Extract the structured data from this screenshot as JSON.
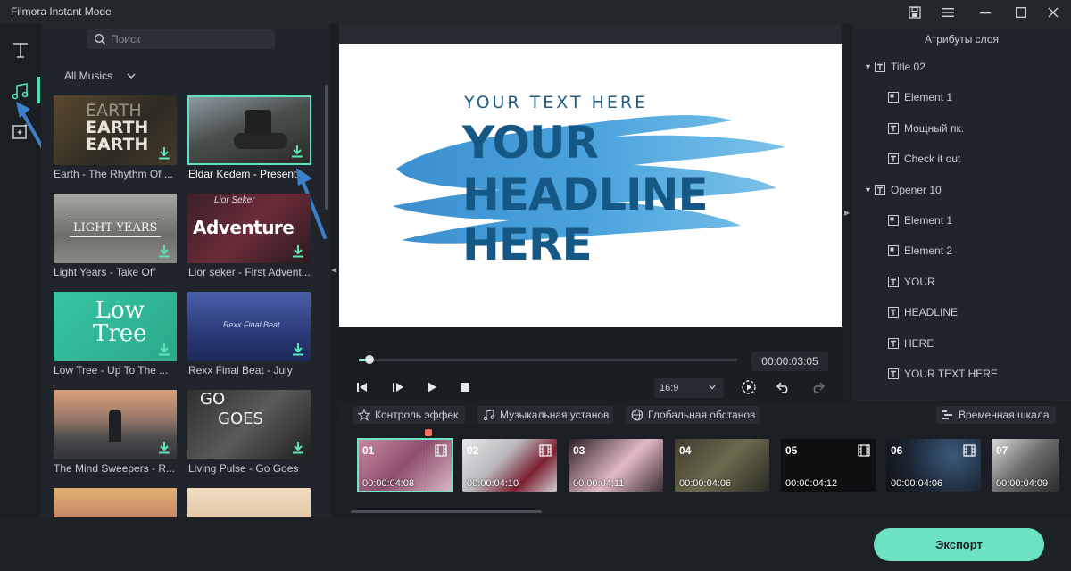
{
  "window": {
    "title": "Filmora Instant Mode"
  },
  "library": {
    "search_placeholder": "Поиск",
    "filter": "All Musics",
    "items": [
      {
        "caption": "Earth - The Rhythm Of ..."
      },
      {
        "caption": "Eldar Kedem - Present"
      },
      {
        "caption": "Light Years - Take Off"
      },
      {
        "caption": "Lior seker - First Advent..."
      },
      {
        "caption": "Low Tree - Up To The ..."
      },
      {
        "caption": "Rexx Final Beat - July"
      },
      {
        "caption": "The Mind Sweepers - R..."
      },
      {
        "caption": "Living Pulse - Go Goes"
      }
    ],
    "thumb_text": {
      "earth": [
        "EARTH",
        "EARTH",
        "EARTH"
      ],
      "light_years": "LIGHT YEARS",
      "adventure": "Adventure",
      "adventure_top": "Lior Seker",
      "low_tree": [
        "Low",
        "Tree"
      ],
      "rexx": "Rexx Final Beat",
      "go_goes": [
        "GO",
        "GOES"
      ]
    }
  },
  "preview": {
    "kicker": "YOUR TEXT HERE",
    "headline": [
      "YOUR",
      "HEADLINE",
      "HERE"
    ],
    "timecode": "00:00:03:05",
    "aspect_ratio": "16:9",
    "progress_fraction": 0.02
  },
  "attributes": {
    "title": "Атрибуты слоя",
    "tree": [
      {
        "label": "Title 02",
        "level": 0
      },
      {
        "label": "Element 1",
        "level": 1
      },
      {
        "label": "Мощный пк.",
        "level": 1
      },
      {
        "label": "Check it out",
        "level": 1
      },
      {
        "label": "Opener 10",
        "level": 0
      },
      {
        "label": "Element 1",
        "level": 1
      },
      {
        "label": "Element 2",
        "level": 1
      },
      {
        "label": "YOUR",
        "level": 1
      },
      {
        "label": "HEADLINE",
        "level": 1
      },
      {
        "label": "HERE",
        "level": 1
      },
      {
        "label": "YOUR TEXT HERE",
        "level": 1
      }
    ]
  },
  "tabs": {
    "effects": "Контроль эффек",
    "music": "Музыкальная установ",
    "global": "Глобальная обстанов",
    "timeline": "Временная шкала"
  },
  "timeline": {
    "clips": [
      {
        "num": "01",
        "time": "00:00:04:08"
      },
      {
        "num": "02",
        "time": "00:00:04:10"
      },
      {
        "num": "03",
        "time": "00:00:04:11"
      },
      {
        "num": "04",
        "time": "00:00:04:06"
      },
      {
        "num": "05",
        "time": "00:00:04:12"
      },
      {
        "num": "06",
        "time": "00:00:04:06"
      },
      {
        "num": "07",
        "time": "00:00:04:09"
      }
    ]
  },
  "footer": {
    "export_label": "Экспорт"
  },
  "colors": {
    "accent": "#6be3c3",
    "playhead": "#ff6a5c",
    "headline": "#155785"
  }
}
